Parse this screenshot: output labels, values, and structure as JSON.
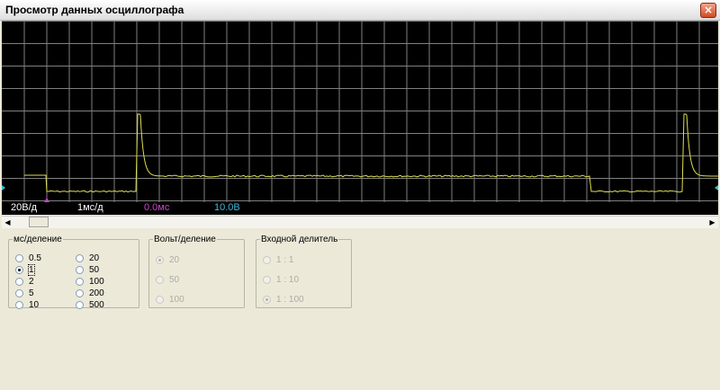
{
  "window": {
    "title": "Просмотр данных осциллографа",
    "close_icon": "close-icon"
  },
  "status": {
    "volts_div": "20В/д",
    "time_div": "1мс/д",
    "time_offset": "0.0мс",
    "voltage_readout": "10.0В"
  },
  "groups": {
    "time": {
      "legend": "мс/деление",
      "options": [
        "0.5",
        "1",
        "2",
        "5",
        "10",
        "20",
        "50",
        "100",
        "200",
        "500"
      ],
      "selected": "1"
    },
    "volt": {
      "legend": "Вольт/деление",
      "options": [
        "20",
        "50",
        "100"
      ],
      "selected": "20"
    },
    "divider": {
      "legend": "Входной делитель",
      "options": [
        "1 : 1",
        "1 : 10",
        "1 : 100"
      ],
      "selected": "1 : 100"
    }
  },
  "colors": {
    "grid": "#808080",
    "trace": "#dede54",
    "offset_text": "#d040d0",
    "voltage_text": "#40b8d8",
    "status_text": "#ffffff",
    "marker": "#30c0d8",
    "trigger_marker": "#d040d0"
  }
}
